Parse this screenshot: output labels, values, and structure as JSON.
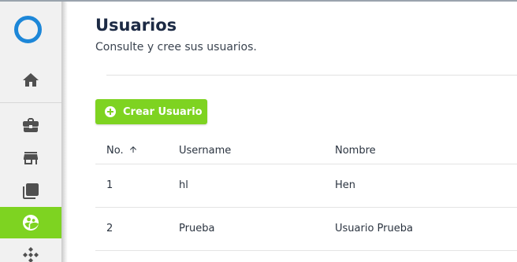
{
  "page": {
    "title": "Usuarios",
    "subtitle": "Consulte y cree sus usuarios."
  },
  "actions": {
    "create_label": "Crear Usuario"
  },
  "sidebar": {
    "items": [
      {
        "icon": "home-icon"
      },
      {
        "icon": "briefcase-icon"
      },
      {
        "icon": "store-icon"
      },
      {
        "icon": "layers-icon"
      },
      {
        "icon": "users-icon",
        "active": true
      },
      {
        "icon": "network-icon"
      }
    ]
  },
  "table": {
    "headers": {
      "no": "No.",
      "username": "Username",
      "name": "Nombre"
    },
    "sort": {
      "column": "No.",
      "direction": "ascending"
    },
    "rows": [
      {
        "no": "1",
        "username": "hl",
        "name": "Hen"
      },
      {
        "no": "2",
        "username": "Prueba",
        "name": "Usuario Prueba"
      }
    ]
  },
  "colors": {
    "accent": "#7ed321",
    "logo": "#1d87d8",
    "title": "#1c2a44"
  }
}
